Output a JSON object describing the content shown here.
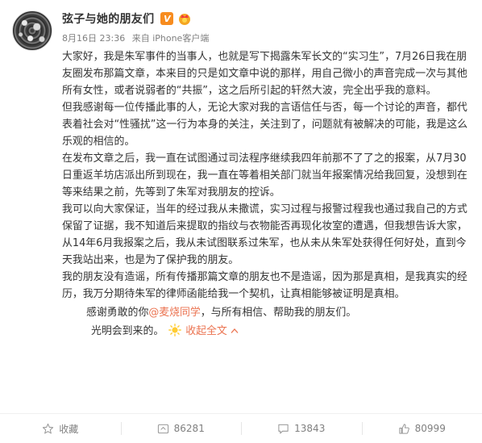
{
  "user": {
    "name": "弦子与她的朋友们",
    "vip_badge": "V",
    "time": "8月16日 23:36",
    "source": "来自 iPhone客户端"
  },
  "paragraphs": [
    "大家好，我是朱军事件的当事人，也就是写下揭露朱军长文的“实习生”，7月26日我在朋友圈发布那篇文章，本来目的只是如文章中说的那样，用自己微小的声音完成一次与其他所有女性，或者说弱者的“共振”，这之后所引起的轩然大波，完全出乎我的意料。",
    "但我感谢每一位传播此事的人，无论大家对我的言语信任与否，每一个讨论的声音，都代表着社会对“性骚扰”这一行为本身的关注，关注到了，问题就有被解决的可能，我是这么乐观的相信的。",
    "在发布文章之后，我一直在试图通过司法程序继续我四年前那不了了之的报案，从7月30日重返羊坊店派出所到现在，我一直在等着相关部门就当年报案情况给我回复，没想到在等来结果之前，先等到了朱军对我朋友的控诉。",
    "我可以向大家保证，当年的经过我从未撒谎，实习过程与报警过程我也通过我自己的方式保留了证据，我不知道后来提取的指纹与衣物能否再现化妆室的遭遇，但我想告诉大家，从14年6月我报案之后，我从未试图联系过朱军，也从未从朱军处获得任何好处，直到今天我站出来，也是为了保护我的朋友。",
    "我的朋友没有造谣，所有传播那篇文章的朋友也不是造谣，因为那是真相，是我真实的经历，我万分期待朱军的律师函能给我一个契机，让真相能够被证明是真相。"
  ],
  "thanks": {
    "prefix": "感谢勇敢的你",
    "mention": "@麦烧同学",
    "suffix": "，与所有相信、帮助我的朋友们。"
  },
  "closing": {
    "text": "光明会到来的。",
    "collapse_label": "收起全文"
  },
  "actions": {
    "favorite_label": "收藏",
    "repost_count": "86281",
    "comment_count": "13843",
    "like_count": "80999"
  },
  "colors": {
    "link": "#eb7350",
    "meta": "#808080",
    "vip_badge": "#f78c1f"
  },
  "icons": [
    "avatar",
    "vip-icon",
    "crown-icon",
    "sun-icon",
    "chevron-up-icon",
    "star-icon",
    "repost-icon",
    "comment-icon",
    "like-icon"
  ]
}
